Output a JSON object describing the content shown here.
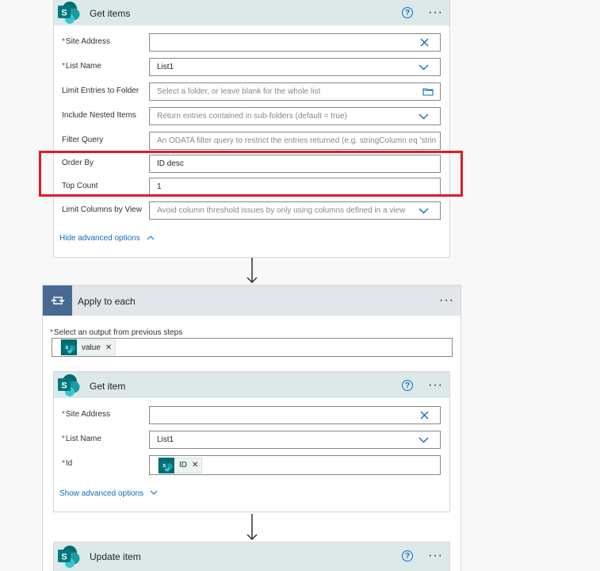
{
  "get_items": {
    "title": "Get items",
    "fields": [
      {
        "label": "Site Address",
        "required": true,
        "value": "",
        "placeholder": "",
        "icon": "clear-icon"
      },
      {
        "label": "List Name",
        "required": true,
        "value": "List1",
        "placeholder": "",
        "icon": "chevron-down-icon"
      },
      {
        "label": "Limit Entries to Folder",
        "required": false,
        "value": "",
        "placeholder": "Select a folder, or leave blank for the whole list",
        "icon": "folder-icon"
      },
      {
        "label": "Include Nested Items",
        "required": false,
        "value": "",
        "placeholder": "Return entries contained in sub-folders (default = true)",
        "icon": "chevron-down-icon"
      },
      {
        "label": "Filter Query",
        "required": false,
        "value": "",
        "placeholder": "An ODATA filter query to restrict the entries returned (e.g. stringColumn eq 'strin",
        "icon": ""
      },
      {
        "label": "Order By",
        "required": false,
        "value": "ID desc",
        "placeholder": "",
        "icon": ""
      },
      {
        "label": "Top Count",
        "required": false,
        "value": "1",
        "placeholder": "",
        "icon": ""
      },
      {
        "label": "Limit Columns by View",
        "required": false,
        "value": "",
        "placeholder": "Avoid column threshold issues by only using columns defined in a view",
        "icon": "chevron-down-icon"
      }
    ],
    "advanced_link": "Hide advanced options"
  },
  "apply_to_each": {
    "title": "Apply to each",
    "select_label": "Select an output from previous steps",
    "token": "value"
  },
  "get_item": {
    "title": "Get item",
    "fields": [
      {
        "label": "Site Address",
        "required": true,
        "value": "",
        "icon": "clear-icon"
      },
      {
        "label": "List Name",
        "required": true,
        "value": "List1",
        "icon": "chevron-down-icon"
      },
      {
        "label": "Id",
        "required": true,
        "token": "ID",
        "icon": ""
      }
    ],
    "advanced_link": "Show advanced options"
  },
  "update_item": {
    "title": "Update item"
  },
  "colors": {
    "header_bg": "#dce9e8",
    "loop_header_bg": "#e2e5ea",
    "loop_icon_bg": "#486991",
    "sharepoint": "#036c70",
    "link": "#0f6cbd",
    "highlight": "#e01b24"
  },
  "icons": {
    "sharepoint": "sharepoint-logo-icon",
    "help": "help-icon",
    "more": "more-options-icon",
    "loop": "loop-icon",
    "arrow": "arrow-down-icon"
  }
}
